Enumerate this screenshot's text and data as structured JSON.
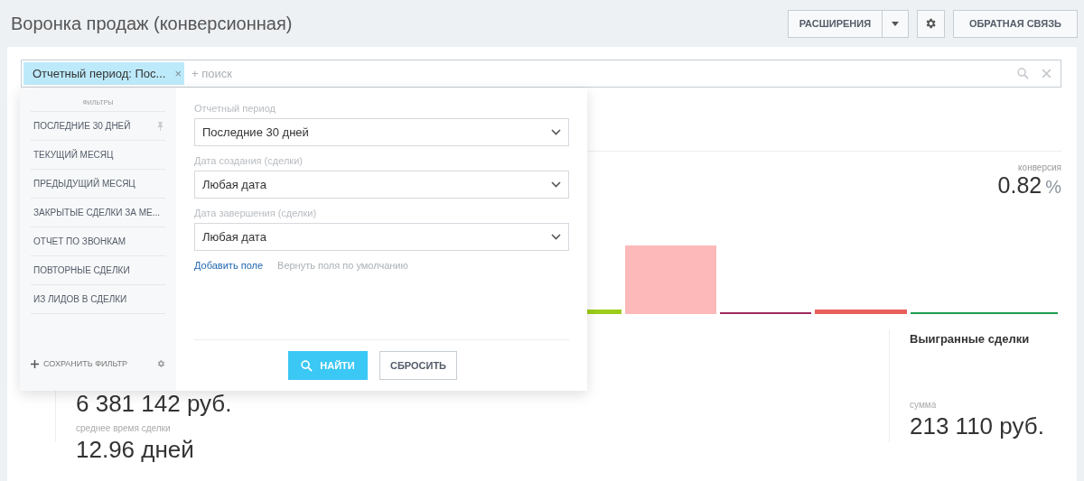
{
  "page_title": "Воронка продаж (конверсионная)",
  "header_buttons": {
    "extensions": "РАСШИРЕНИЯ",
    "feedback": "ОБРАТНАЯ СВЯЗЬ"
  },
  "search": {
    "tag": "Отчетный период: Пос...",
    "tag_close": "×",
    "placeholder": "+ поиск"
  },
  "filter_popup": {
    "sidebar_title": "ФИЛЬТРЫ",
    "presets": [
      {
        "label": "ПОСЛЕДНИЕ 30 ДНЕЙ",
        "pinned": true
      },
      {
        "label": "ТЕКУЩИЙ МЕСЯЦ",
        "pinned": false
      },
      {
        "label": "ПРЕДЫДУЩИЙ МЕСЯЦ",
        "pinned": false
      },
      {
        "label": "ЗАКРЫТЫЕ СДЕЛКИ ЗА МЕ...",
        "pinned": false
      },
      {
        "label": "ОТЧЕТ ПО ЗВОНКАМ",
        "pinned": false
      },
      {
        "label": "ПОВТОРНЫЕ СДЕЛКИ",
        "pinned": false
      },
      {
        "label": "ИЗ ЛИДОВ В СДЕЛКИ",
        "pinned": false
      }
    ],
    "save_filter": "СОХРАНИТЬ ФИЛЬТР",
    "fields": [
      {
        "label": "Отчетный период",
        "value": "Последние 30 дней"
      },
      {
        "label": "Дата создания (сделки)",
        "value": "Любая дата"
      },
      {
        "label": "Дата завершения (сделки)",
        "value": "Любая дата"
      }
    ],
    "add_field": "Добавить поле",
    "reset_fields": "Вернуть поля по умолчанию",
    "find_button": "НАЙТИ",
    "reset_button": "СБРОСИТЬ"
  },
  "conversion": {
    "label": "конверсия",
    "value": "0.82",
    "unit": "%"
  },
  "left_stats": {
    "amount": "6 381 142 руб.",
    "avg_time_label": "среднее время сделки",
    "avg_time": "12.96 дней"
  },
  "won": {
    "title": "Выигранные сделки",
    "sum_label": "сумма",
    "sum": "213 110 руб."
  }
}
